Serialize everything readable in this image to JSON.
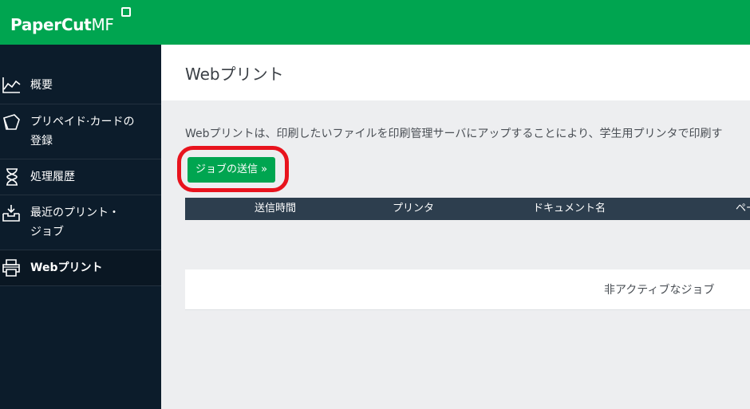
{
  "brand": {
    "name_bold": "PaperCut",
    "name_light": "MF"
  },
  "sidebar": {
    "items": [
      {
        "label": "概要",
        "icon": "chart-line-icon"
      },
      {
        "label_lines": [
          "プリペイド·カードの",
          "登録"
        ],
        "icon": "card-icon"
      },
      {
        "label": "処理履歴",
        "icon": "hourglass-icon"
      },
      {
        "label_lines": [
          "最近のプリント・",
          "ジョブ"
        ],
        "icon": "inbox-tray-icon"
      },
      {
        "label": "Webプリント",
        "icon": "printer-icon",
        "active": true
      }
    ]
  },
  "main": {
    "title": "Webプリント",
    "description": "Webプリントは、印刷したいファイルを印刷管理サーバにアップすることにより、学生用プリンタで印刷す",
    "submit_button": "ジョブの送信 »",
    "table": {
      "columns": [
        "送信時間",
        "プリンタ",
        "ドキュメント名",
        "ペー"
      ],
      "empty_message": "非アクティブなジョブ"
    }
  },
  "colors": {
    "brand_green": "#00a550",
    "sidebar_bg": "#0c1c2b",
    "table_header": "#2d3e4e",
    "highlight": "#e8131d"
  }
}
